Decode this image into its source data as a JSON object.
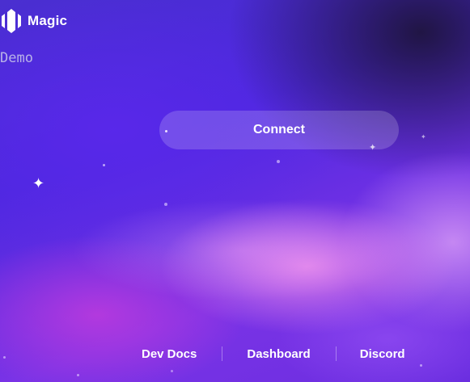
{
  "brand": {
    "name": "Magic",
    "logo_icon": "magic-logo-icon"
  },
  "subtitle": "Demo",
  "connect": {
    "label": "Connect"
  },
  "footer": {
    "links": [
      {
        "label": "Dev Docs"
      },
      {
        "label": "Dashboard"
      },
      {
        "label": "Discord"
      }
    ]
  },
  "colors": {
    "background_primary": "#4a25d6",
    "background_dark": "#1e143c",
    "glow_pink": "#ec8ceb",
    "text": "#ffffff",
    "subtitle_text": "#b9b2e8"
  }
}
